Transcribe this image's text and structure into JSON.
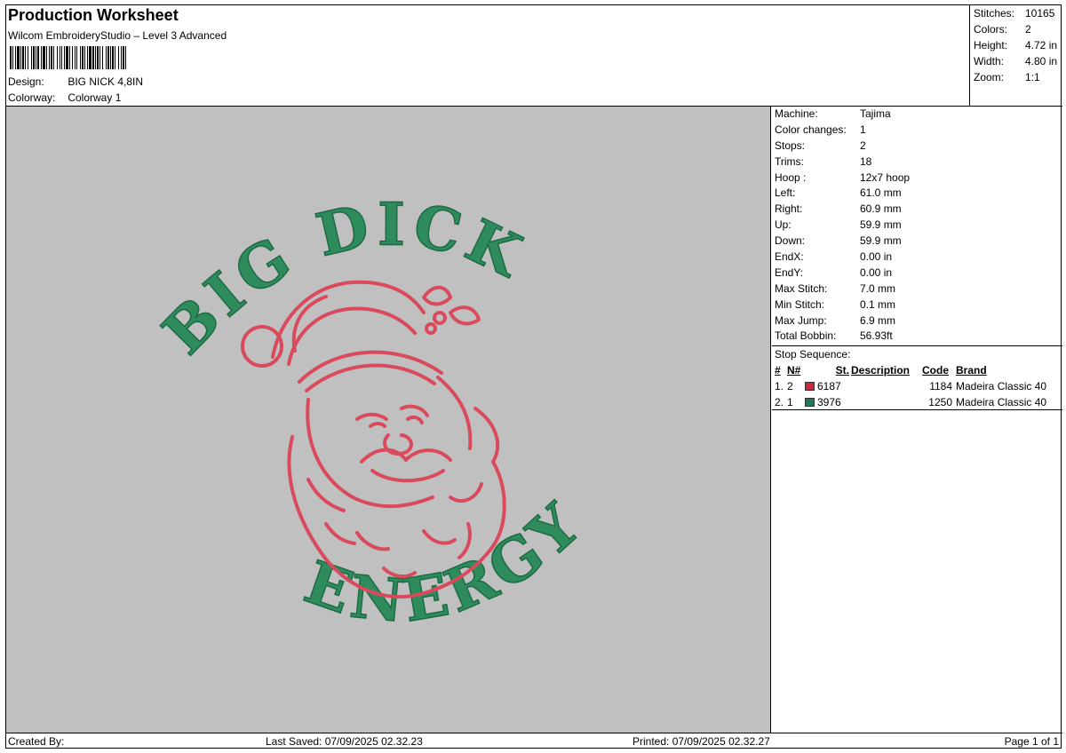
{
  "header": {
    "title": "Production Worksheet",
    "subtitle": "Wilcom EmbroideryStudio – Level 3 Advanced",
    "design_label": "Design:",
    "design_value": "BIG NICK 4,8IN",
    "colorway_label": "Colorway:",
    "colorway_value": "Colorway 1"
  },
  "summary": [
    {
      "label": "Stitches:",
      "value": "10165"
    },
    {
      "label": "Colors:",
      "value": "2"
    },
    {
      "label": "Height:",
      "value": "4.72 in"
    },
    {
      "label": "Width:",
      "value": "4.80 in"
    },
    {
      "label": "Zoom:",
      "value": "1:1"
    }
  ],
  "machine_info": [
    {
      "label": "Machine:",
      "value": "Tajima"
    },
    {
      "label": "Color changes:",
      "value": "1"
    },
    {
      "label": "Stops:",
      "value": "2"
    },
    {
      "label": "Trims:",
      "value": "18"
    },
    {
      "label": "Hoop :",
      "value": "12x7 hoop"
    },
    {
      "label": "Left:",
      "value": "61.0 mm"
    },
    {
      "label": "Right:",
      "value": "60.9 mm"
    },
    {
      "label": "Up:",
      "value": "59.9 mm"
    },
    {
      "label": "Down:",
      "value": "59.9 mm"
    },
    {
      "label": "EndX:",
      "value": "0.00 in"
    },
    {
      "label": "EndY:",
      "value": "0.00 in"
    },
    {
      "label": "Max Stitch:",
      "value": "7.0 mm"
    },
    {
      "label": "Min Stitch:",
      "value": "0.1 mm"
    },
    {
      "label": "Max Jump:",
      "value": "6.9 mm"
    },
    {
      "label": "Total Bobbin:",
      "value": "56.93ft"
    }
  ],
  "stop_sequence": {
    "label": "Stop Sequence:",
    "headers": {
      "num": "#",
      "n": "N#",
      "st": "St.",
      "desc": "Description",
      "code": "Code",
      "brand": "Brand"
    },
    "rows": [
      {
        "num": "1.",
        "n": "2",
        "color": "#c8283c",
        "st": "6187",
        "desc": "",
        "code": "1184",
        "brand": "Madeira Classic 40"
      },
      {
        "num": "2.",
        "n": "1",
        "color": "#1a7a55",
        "st": "3976",
        "desc": "",
        "code": "1250",
        "brand": "Madeira Classic 40"
      }
    ]
  },
  "design_art": {
    "text_top": "BIG DICK",
    "text_bottom": "ENERGY",
    "green": "#2e8b5c",
    "red": "#d94a5c",
    "background": "#c0c0c0"
  },
  "footer": {
    "created_by": "Created By:",
    "last_saved": "Last Saved: 07/09/2025 02.32.23",
    "printed": "Printed: 07/09/2025 02.32.27",
    "page": "Page 1 of 1"
  }
}
